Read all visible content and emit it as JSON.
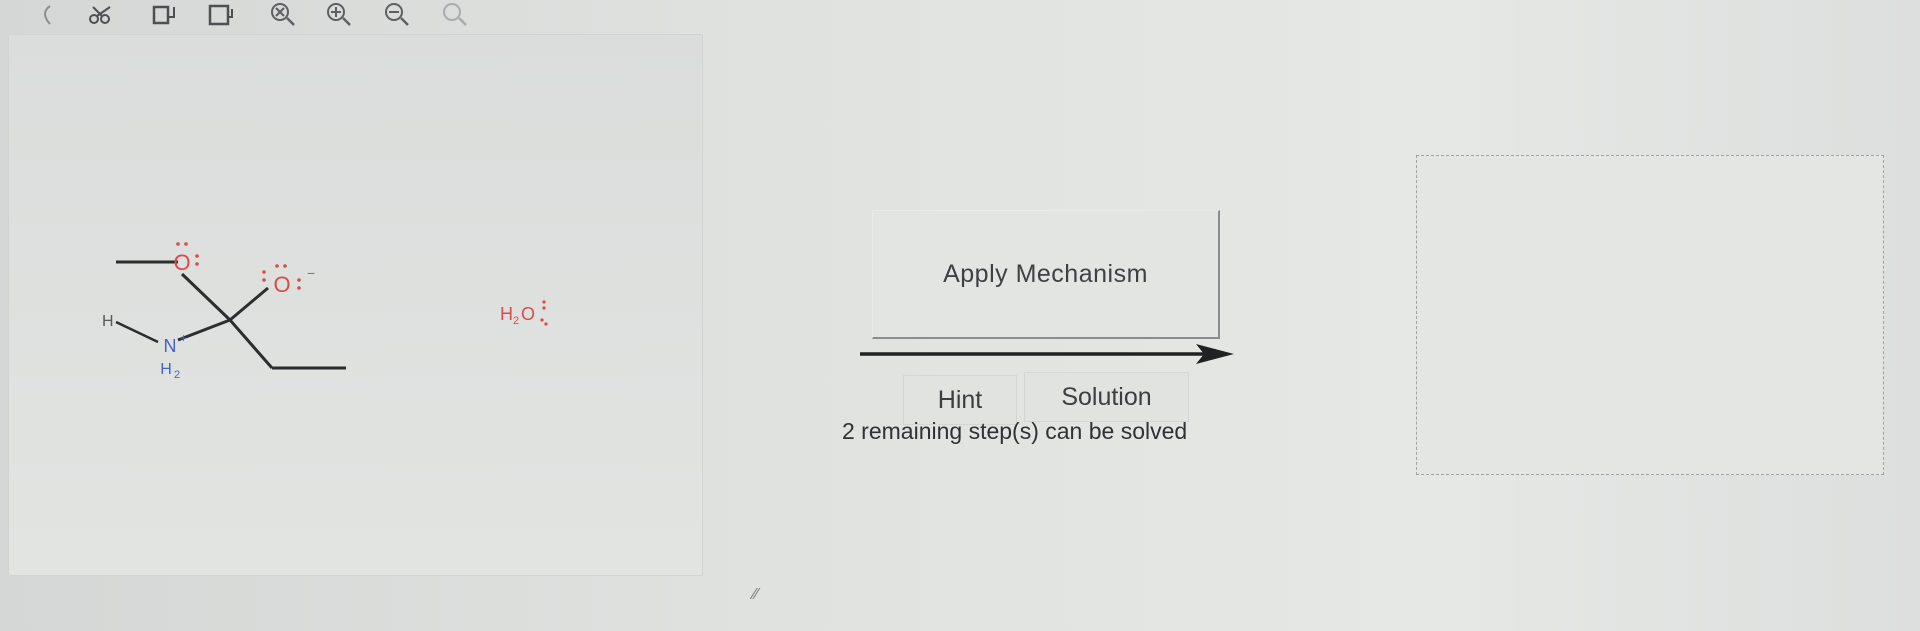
{
  "toolbar": {
    "tools": [
      {
        "name": "undo-icon"
      },
      {
        "name": "cut-icon"
      },
      {
        "name": "copy-icon"
      },
      {
        "name": "paste-icon"
      },
      {
        "name": "clear-icon"
      },
      {
        "name": "zoom-in-icon"
      },
      {
        "name": "zoom-out-icon"
      },
      {
        "name": "zoom-reset-icon"
      }
    ]
  },
  "reactants": {
    "molecule": {
      "h_label": "H",
      "n_label": "N",
      "n_charge": "+",
      "h2_label": "H",
      "h2_sub": "2",
      "o1_label": "O",
      "o2_label": "O",
      "o2_charge": "−"
    },
    "water": {
      "label_h": "H",
      "label_sub": "2",
      "label_o": "O"
    }
  },
  "mechanism": {
    "apply_label": "Apply Mechanism",
    "hint_label": "Hint",
    "solution_label": "Solution",
    "remaining_text": "2 remaining step(s) can be solved"
  },
  "colors": {
    "bond": "#2b2d2f",
    "oxygen": "#d94b4b",
    "nitrogen": "#4a62c7",
    "hydrogen": "#555a5e"
  }
}
